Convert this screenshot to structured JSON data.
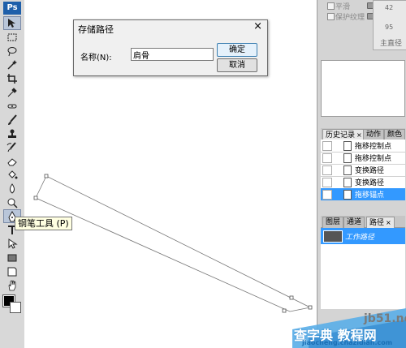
{
  "toolbox": {
    "logo": "Ps",
    "tools": [
      "move-icon",
      "marquee-icon",
      "lasso-icon",
      "magic-wand-icon",
      "crop-icon",
      "eyedropper-icon",
      "healing-icon",
      "brush-icon",
      "stamp-icon",
      "history-brush-icon",
      "eraser-icon",
      "paint-bucket-icon",
      "blur-icon",
      "dodge-icon",
      "pen-icon",
      "type-icon",
      "path-select-icon",
      "shape-icon",
      "notes-icon",
      "eyedropper2-icon",
      "hand-icon",
      "zoom-icon"
    ]
  },
  "dialog": {
    "title": "存储路径",
    "close": "×",
    "name_label": "名称(N):",
    "name_value": "肩骨",
    "ok_label": "确定",
    "cancel_label": "取消"
  },
  "tooltip": {
    "text": "钢笔工具 (P)"
  },
  "layers_options": {
    "flat_label": "平滑",
    "keep_texture_label": "保护纹理",
    "nav_numbers": [
      "42",
      "95"
    ],
    "main_path_label": "主直径"
  },
  "history_panel": {
    "tabs": [
      {
        "label": "历史记录",
        "close": "×"
      },
      {
        "label": "动作"
      },
      {
        "label": "颜色"
      }
    ],
    "items": [
      "拖移控制点",
      "拖移控制点",
      "变换路径",
      "变换路径",
      "拖移锚点"
    ],
    "selected_index": 4
  },
  "paths_panel": {
    "tabs": [
      {
        "label": "图层"
      },
      {
        "label": "通道"
      },
      {
        "label": "路径",
        "close": "×"
      }
    ],
    "work_path": "工作路径"
  },
  "watermark": {
    "domain": "jb51.net",
    "cn": "查字典  教程网",
    "url": "jiaocheng.chazidian.com"
  },
  "colors": {
    "selection": "#3399ff",
    "ps_logo": "#1e5faa",
    "panel_bg": "#d4d4d4"
  }
}
